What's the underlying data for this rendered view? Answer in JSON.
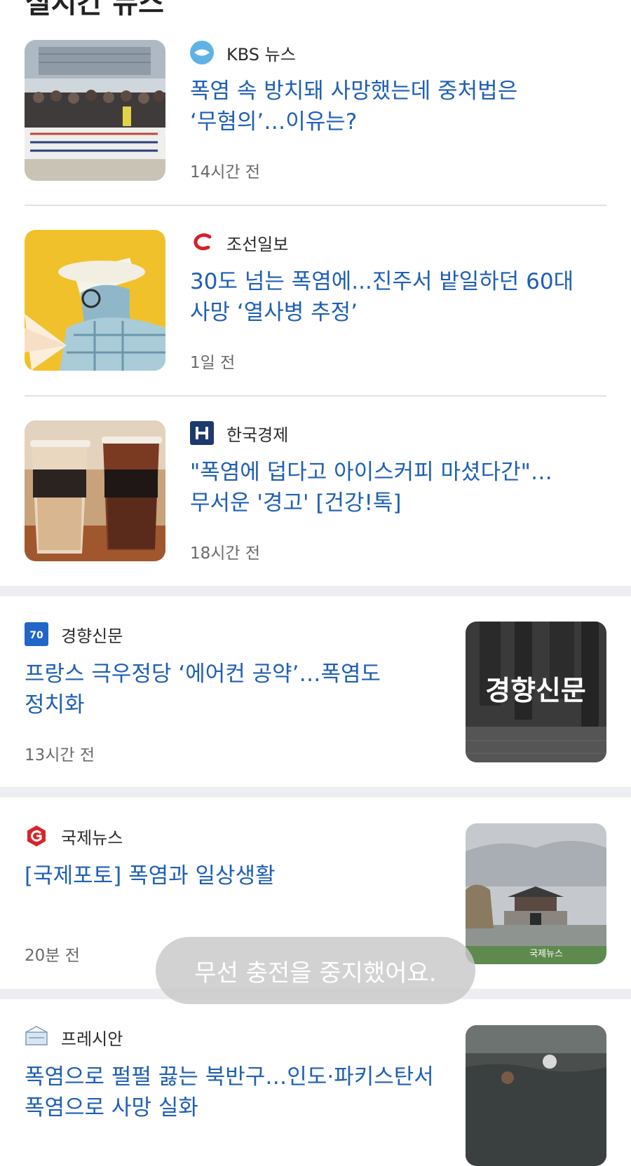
{
  "section_title": "실시간 뉴스",
  "articles": [
    {
      "source": "KBS 뉴스",
      "source_logo": "kbs-logo-icon",
      "headline": "폭염 속 방치돼 사망했는데 중처법은 ‘무혐의’…이유는?",
      "time": "14시간 전",
      "thumbnail": "protest-crowd-image"
    },
    {
      "source": "조선일보",
      "source_logo": "chosun-logo-icon",
      "headline": "30도 넘는 폭염에...진주서 밭일하던 60대 사망 ‘열사병 추정’",
      "time": "1일 전",
      "thumbnail": "man-with-fan-illustration"
    },
    {
      "source": "한국경제",
      "source_logo": "hankyung-logo-icon",
      "headline": "\"폭염에 덥다고 아이스커피 마셨다간\"…무서운 '경고' [건강!톡]",
      "time": "18시간 전",
      "thumbnail": "iced-coffee-image"
    },
    {
      "source": "경향신문",
      "source_logo": "kyunghyang-logo-icon",
      "headline": "프랑스 극우정당 ‘에어컨 공약’…폭염도 정치화",
      "time": "13시간 전",
      "thumbnail": "kyunghyang-placeholder-image",
      "thumbnail_text": "경향신문"
    },
    {
      "source": "국제뉴스",
      "source_logo": "gukje-logo-icon",
      "headline": "[국제포토] 폭염과 일상생활",
      "time": "20분 전",
      "thumbnail": "palace-photo-image",
      "thumbnail_watermark": "국제뉴스"
    },
    {
      "source": "프레시안",
      "source_logo": "pressian-logo-icon",
      "headline": "폭염으로 펄펄 끓는 북반구…인도·파키스탄서 폭염으로 사망 실화",
      "time": "",
      "thumbnail": "flood-photo-image"
    }
  ],
  "toast": {
    "message": "무선 충전을 중지했어요."
  },
  "colors": {
    "headline": "#1f5fb4",
    "source_text": "#2b2b2b",
    "time_text": "#6a6a6a",
    "divider": "#e2e2e2",
    "band": "#eceef1"
  }
}
